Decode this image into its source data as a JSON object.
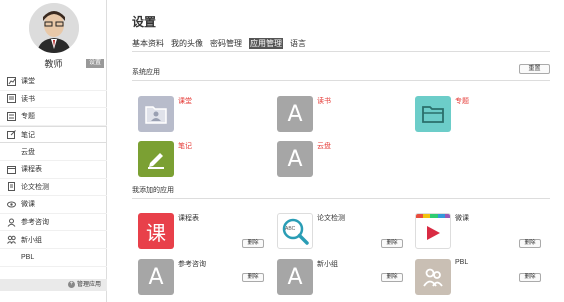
{
  "user": {
    "name": "教师",
    "settings_label": "设置"
  },
  "sidebar": {
    "items": [
      {
        "label": "课堂",
        "icon": "chart-icon"
      },
      {
        "label": "读书",
        "icon": "book-icon"
      },
      {
        "label": "专题",
        "icon": "list-icon"
      },
      {
        "label": "笔记",
        "icon": "edit-icon"
      },
      {
        "label": "云盘",
        "icon": ""
      },
      {
        "label": "课程表",
        "icon": "calendar-icon"
      },
      {
        "label": "论文检测",
        "icon": "document-icon"
      },
      {
        "label": "微课",
        "icon": "eye-icon"
      },
      {
        "label": "参考咨询",
        "icon": "people-icon"
      },
      {
        "label": "新小组",
        "icon": "group-icon"
      },
      {
        "label": "PBL",
        "icon": ""
      }
    ],
    "manage_label": "管理应用"
  },
  "page": {
    "title": "设置",
    "tabs": [
      "基本资料",
      "我的头像",
      "密码管理",
      "应用管理",
      "语言"
    ],
    "active_tab": "应用管理"
  },
  "system_apps": {
    "label": "系统应用",
    "reset_label": "重置",
    "items": [
      {
        "name": "课堂",
        "icon": "classroom-icon",
        "color": "#b8bccb"
      },
      {
        "name": "读书",
        "icon": "letter-a-icon",
        "color": "#a6a6a6",
        "letter": "A"
      },
      {
        "name": "专题",
        "icon": "folder-icon",
        "color": "#6ccdc9"
      },
      {
        "name": "笔记",
        "icon": "pen-icon",
        "color": "#7ba033"
      },
      {
        "name": "云盘",
        "icon": "letter-a-icon",
        "color": "#a6a6a6",
        "letter": "A"
      }
    ]
  },
  "my_apps": {
    "label": "我添加的应用",
    "delete_label": "删除",
    "items": [
      {
        "name": "课程表",
        "icon": "timetable-icon",
        "color": "#e8404a",
        "letter": "课"
      },
      {
        "name": "论文检测",
        "icon": "abc-search-icon",
        "color": "#ffffff",
        "letter": "ABC"
      },
      {
        "name": "微课",
        "icon": "play-icon",
        "color": "#ffffff"
      },
      {
        "name": "参考咨询",
        "icon": "letter-a-icon",
        "color": "#a6a6a6",
        "letter": "A"
      },
      {
        "name": "新小组",
        "icon": "letter-a-icon",
        "color": "#a6a6a6",
        "letter": "A"
      },
      {
        "name": "PBL",
        "icon": "people-icon",
        "color": "#c9bfb4"
      }
    ]
  },
  "colors": {
    "accent_red": "#e53935",
    "active_tab_bg": "#555555"
  }
}
